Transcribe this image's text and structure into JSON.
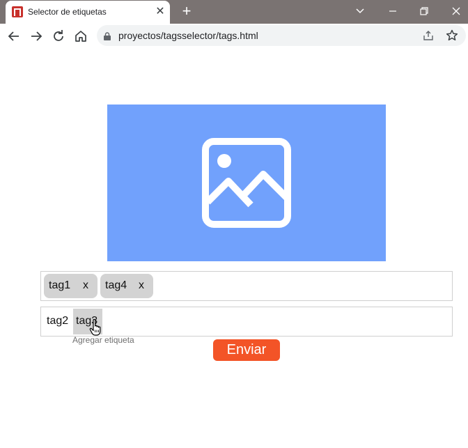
{
  "browser": {
    "tab_title": "Selector de etiquetas",
    "tab_close": "✕",
    "new_tab": "+",
    "url": "proyectos/tagsselector/tags.html",
    "icons": {
      "favicon": "app-favicon-icon",
      "back": "arrow-left-icon",
      "forward": "arrow-right-icon",
      "reload": "reload-icon",
      "home": "home-icon",
      "lock": "lock-icon",
      "share": "share-icon",
      "bookmark": "star-icon",
      "tab_list": "chevron-down-icon",
      "minimize": "minimize-icon",
      "restore": "restore-icon",
      "close": "close-icon"
    },
    "colors": {
      "frame": "#7a7372",
      "favicon": "#c8312c"
    }
  },
  "page": {
    "image_icon": "image-placeholder-icon",
    "image_bg_color": "#71a1fc",
    "selected_tags": [
      {
        "label": "tag1",
        "remove": "x"
      },
      {
        "label": "tag4",
        "remove": "x"
      }
    ],
    "available_tags": [
      {
        "label": "tag2",
        "highlighted": false
      },
      {
        "label": "tag3",
        "highlighted": true
      }
    ],
    "helper_text": "Agregar etiqueta",
    "submit_label": "Enviar",
    "submit_color": "#f35427",
    "cursor": "hand-pointer-icon"
  }
}
